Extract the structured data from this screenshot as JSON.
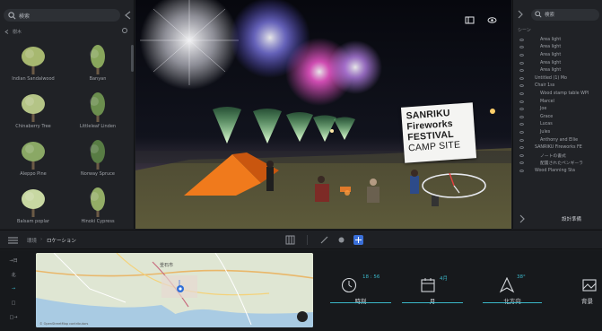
{
  "left_panel": {
    "search_placeholder": "検索",
    "breadcrumb": "樹木",
    "assets": [
      {
        "label": "Indian Sandalwood"
      },
      {
        "label": "Banyan"
      },
      {
        "label": "Chinaberry Tree"
      },
      {
        "label": "Littleleaf Linden"
      },
      {
        "label": "Aleppo Pine"
      },
      {
        "label": "Norway Spruce"
      },
      {
        "label": "Balsam poplar"
      },
      {
        "label": "Hinoki Cypress"
      }
    ]
  },
  "viewport": {
    "sign_lines": [
      "SANRIKU",
      "Fireworks",
      "FESTIVAL",
      "CAMP SITE"
    ]
  },
  "right_panel": {
    "search_placeholder": "検索",
    "header": "シーン",
    "tree_items": [
      {
        "name": "Area light",
        "indent": 2
      },
      {
        "name": "Area light",
        "indent": 2
      },
      {
        "name": "Area light",
        "indent": 2
      },
      {
        "name": "Area light",
        "indent": 2
      },
      {
        "name": "Area light",
        "indent": 2
      },
      {
        "name": "Untitled (1) Mo",
        "indent": 1
      },
      {
        "name": "Chair 1ss",
        "indent": 1
      },
      {
        "name": "Wood stamp table WPI",
        "indent": 2
      },
      {
        "name": "Marcel",
        "indent": 2
      },
      {
        "name": "Joe",
        "indent": 2
      },
      {
        "name": "Grace",
        "indent": 2
      },
      {
        "name": "Lucas",
        "indent": 2
      },
      {
        "name": "Jules",
        "indent": 2
      },
      {
        "name": "Anthony and Ellie",
        "indent": 2
      },
      {
        "name": "SANRIKU Fireworks FE",
        "indent": 1
      },
      {
        "name": "ノートの書式",
        "indent": 2
      },
      {
        "name": "配置されたペンギーラ",
        "indent": 2
      },
      {
        "name": "Wood Planning Sta",
        "indent": 1
      }
    ],
    "bottom_button": "設計準備"
  },
  "bottom_bar": {
    "crumb_root": "環境",
    "crumb_current": "ロケーション"
  },
  "location": {
    "side_buttons": [
      "→日",
      "北",
      "→",
      "□",
      "□→"
    ],
    "map_label": "釜石市",
    "map_credit": "© OpenStreetMap contributors",
    "time": {
      "value": "18 : 56",
      "label": "時刻"
    },
    "month": {
      "value": "4月",
      "label": "月"
    },
    "direction": {
      "value": "38°",
      "label": "北方向"
    },
    "background": {
      "label": "背景"
    }
  },
  "colors": {
    "accent": "#3bb7c9",
    "active_tool": "#3a6fd8",
    "panel_bg": "#202226"
  }
}
